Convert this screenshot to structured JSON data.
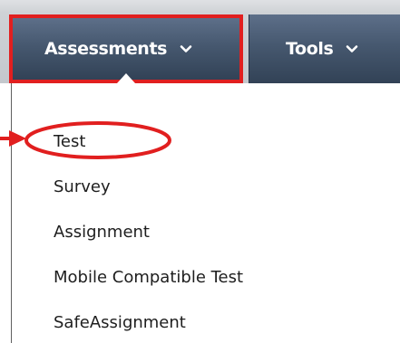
{
  "nav": {
    "assessments_label": "Assessments",
    "tools_label": "Tools"
  },
  "menu": {
    "items": [
      "Test",
      "Survey",
      "Assignment",
      "Mobile Compatible Test",
      "SafeAssignment"
    ]
  },
  "colors": {
    "highlight_red": "#e11f1f",
    "nav_dark": "#3a4a5f",
    "toolbar_gray": "#cfd2d6"
  }
}
